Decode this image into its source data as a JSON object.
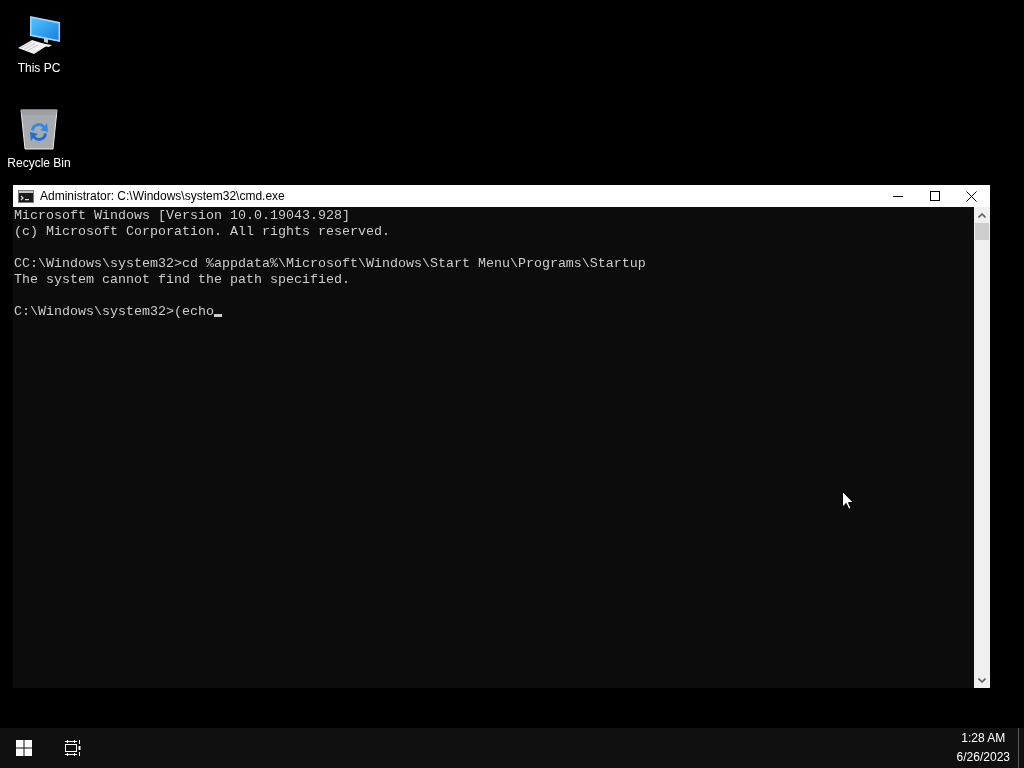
{
  "desktop_icons": [
    {
      "label": "This PC",
      "kind": "computer"
    },
    {
      "label": "Recycle Bin",
      "kind": "recycle-bin"
    }
  ],
  "window": {
    "title": "Administrator: C:\\Windows\\system32\\cmd.exe",
    "console_blocks": [
      [
        "Microsoft Windows [Version 10.0.19043.928]",
        "(c) Microsoft Corporation. All rights reserved."
      ],
      [
        "CC:\\Windows\\system32>cd %appdata%\\Microsoft\\Windows\\Start Menu\\Programs\\Startup",
        "The system cannot find the path specified."
      ],
      [
        "C:\\Windows\\system32>(echo"
      ]
    ]
  },
  "taskbar": {
    "clock": {
      "time": "1:28 AM",
      "date": "6/26/2023"
    }
  }
}
